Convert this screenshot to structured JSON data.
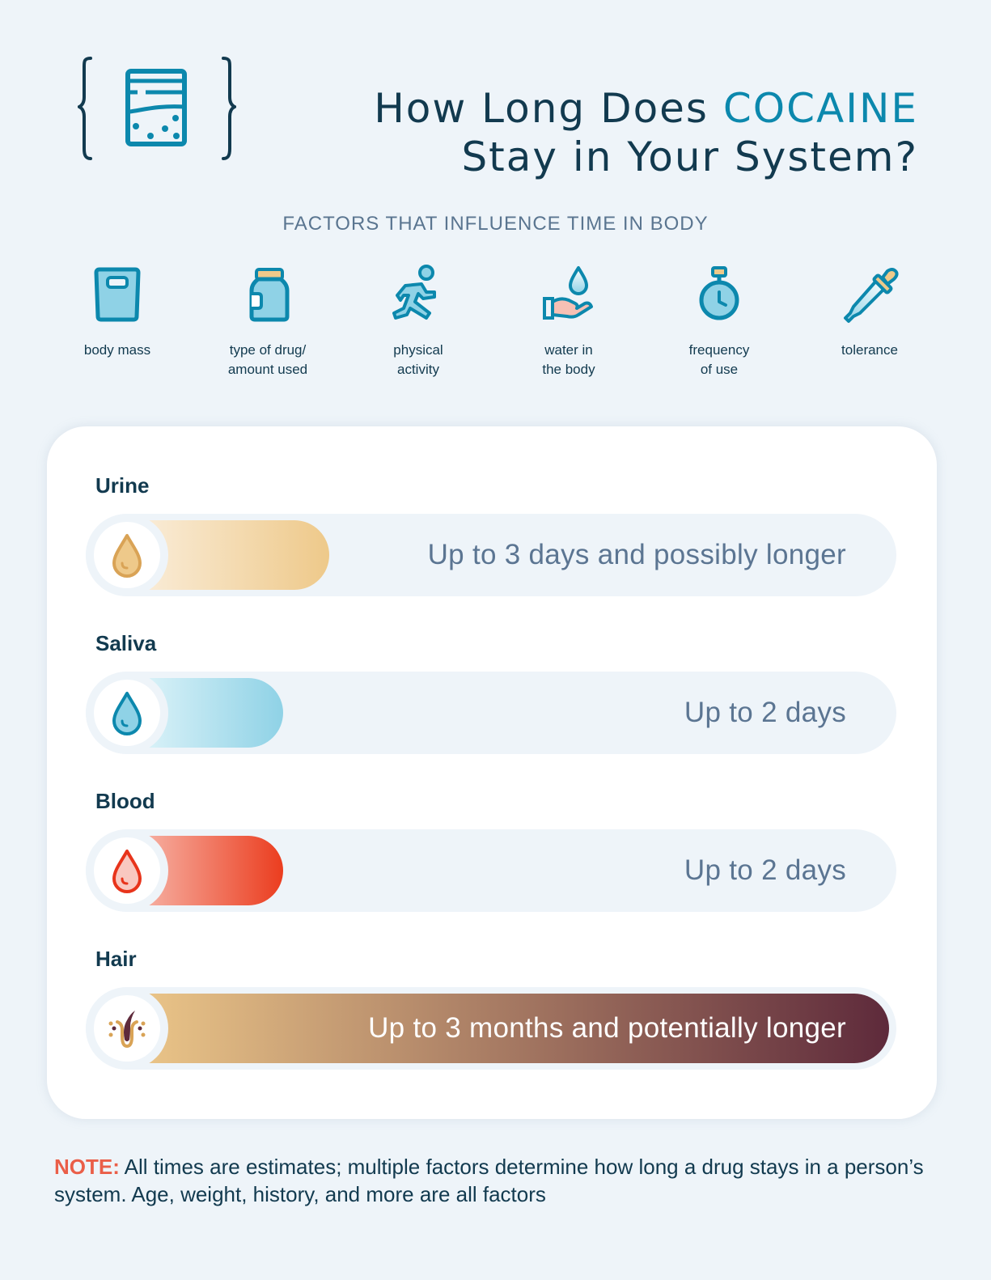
{
  "header": {
    "icon": "drug-bag-icon",
    "title_prefix": "How Long Does ",
    "title_accent": "COCAINE",
    "title_line2": "Stay in Your System?",
    "accent_color": "#0c88ad"
  },
  "factors": {
    "heading": "FACTORS THAT INFLUENCE TIME IN BODY",
    "items": [
      {
        "icon": "scale-icon",
        "label": "body mass"
      },
      {
        "icon": "pill-jar-icon",
        "label": "type of drug/\namount used"
      },
      {
        "icon": "running-person-icon",
        "label": "physical\nactivity"
      },
      {
        "icon": "hand-water-drop-icon",
        "label": "water in\nthe body"
      },
      {
        "icon": "stopwatch-icon",
        "label": "frequency\nof use"
      },
      {
        "icon": "dropper-icon",
        "label": "tolerance"
      }
    ]
  },
  "tests": [
    {
      "name": "Urine",
      "icon": "urine-drop-icon",
      "value": "Up to 3 days and possibly longer",
      "fill_fraction": 0.27,
      "colors": [
        "#fbf0e0",
        "#eec98a"
      ]
    },
    {
      "name": "Saliva",
      "icon": "saliva-drop-icon",
      "value": "Up to 2 days",
      "fill_fraction": 0.21,
      "colors": [
        "#e6f7fb",
        "#8fd2e6"
      ]
    },
    {
      "name": "Blood",
      "icon": "blood-drop-icon",
      "value": "Up to 2 days",
      "fill_fraction": 0.21,
      "colors": [
        "#f8c3b8",
        "#eb3d1f"
      ]
    },
    {
      "name": "Hair",
      "icon": "hair-follicle-icon",
      "value": "Up to 3 months and potentially longer",
      "fill_fraction": 0.99,
      "colors": [
        "#eec98a",
        "#5e2a3b"
      ]
    }
  ],
  "note": {
    "label": "NOTE:",
    "text": " All times are estimates; multiple factors determine how long a drug stays in a person’s system. Age, weight, history, and more are all factors"
  }
}
